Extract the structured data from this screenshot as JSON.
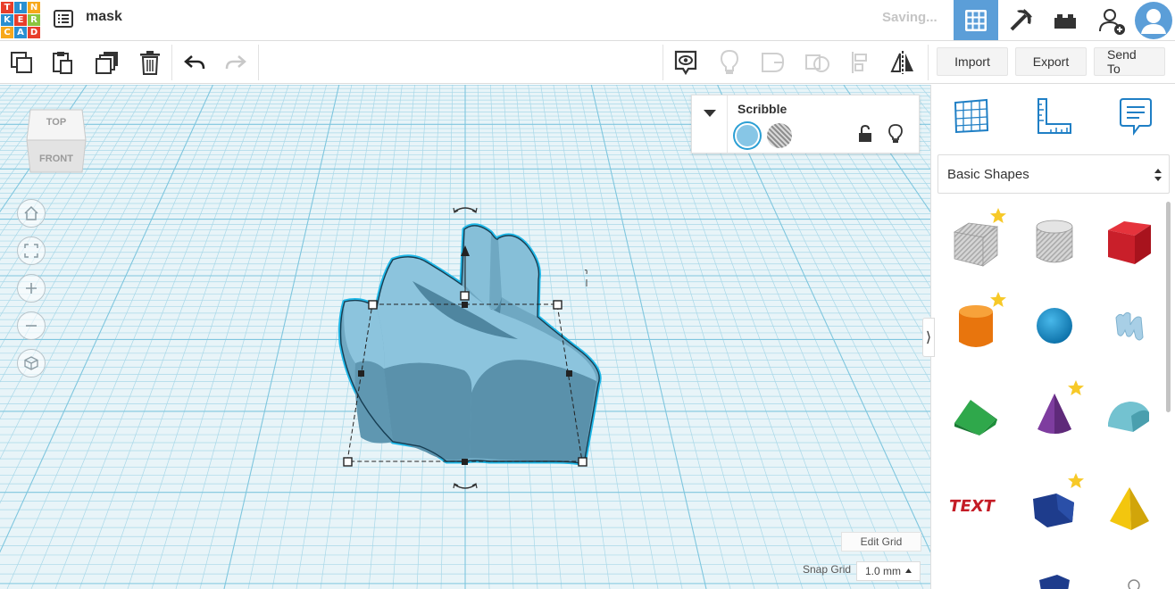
{
  "app": {
    "logo_letters": [
      "T",
      "I",
      "N",
      "K",
      "E",
      "R",
      "C",
      "A",
      "D"
    ],
    "logo_colors": [
      "#e83e2b",
      "#2a8fd1",
      "#f7a81b",
      "#2a8fd1",
      "#e83e2b",
      "#8bc53f",
      "#f7a81b",
      "#2a8fd1",
      "#e83e2b"
    ],
    "design_name": "mask",
    "status_text": "Saving..."
  },
  "header_icons": [
    "grid-view-icon",
    "pickaxe-icon",
    "bricks-icon",
    "add-user-icon",
    "user-avatar"
  ],
  "toolbar": {
    "actions": [
      "copy-icon",
      "paste-icon",
      "duplicate-icon",
      "delete-icon",
      "undo-icon",
      "redo-icon"
    ],
    "view_tools": [
      "show-all-icon",
      "light-bulb-icon",
      "group-icon",
      "ungroup-icon",
      "align-icon",
      "mirror-icon"
    ],
    "import_label": "Import",
    "export_label": "Export",
    "send_to_label": "Send To"
  },
  "viewcube": {
    "top_label": "TOP",
    "front_label": "FRONT"
  },
  "nav_buttons": [
    "home-view-icon",
    "fit-view-icon",
    "zoom-in-icon",
    "zoom-out-icon",
    "perspective-icon"
  ],
  "inspector": {
    "title": "Scribble",
    "solid_color": "#87c6e6",
    "hole_pattern": "striped"
  },
  "right_panel": {
    "tools": [
      "workplane-icon",
      "ruler-icon",
      "notes-icon"
    ],
    "category": "Basic Shapes",
    "shapes": [
      {
        "name": "box-hole",
        "favorite": true
      },
      {
        "name": "cylinder-hole",
        "favorite": false
      },
      {
        "name": "box",
        "favorite": false
      },
      {
        "name": "cylinder",
        "favorite": true
      },
      {
        "name": "sphere",
        "favorite": false
      },
      {
        "name": "scribble",
        "favorite": false
      },
      {
        "name": "roof",
        "favorite": false
      },
      {
        "name": "cone",
        "favorite": true
      },
      {
        "name": "round-roof",
        "favorite": false
      },
      {
        "name": "text",
        "favorite": false
      },
      {
        "name": "polygon",
        "favorite": true
      },
      {
        "name": "pyramid",
        "favorite": false
      }
    ]
  },
  "bottom": {
    "edit_grid_label": "Edit Grid",
    "snap_label": "Snap Grid",
    "snap_value": "1.0 mm"
  },
  "colors": {
    "accent": "#5b9ed8",
    "shape": "#87c6e6",
    "shape_dark": "#6aa3bd",
    "selection": "#1fb8e8",
    "grid_line": "#a9d8e8"
  }
}
